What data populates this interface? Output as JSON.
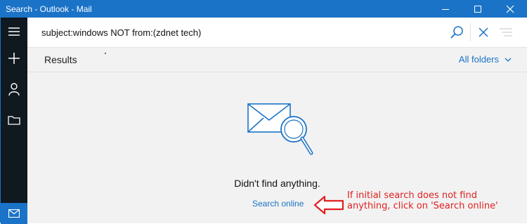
{
  "window": {
    "title": "Search - Outlook - Mail"
  },
  "search": {
    "query": "subject:windows NOT from:(zdnet tech)"
  },
  "results": {
    "label": "Results",
    "folder_filter": "All folders",
    "empty_message": "Didn't find anything.",
    "search_online_label": "Search online"
  },
  "annotation": {
    "text": "If initial search does not find anything, click on 'Search online'",
    "color": "#e02020"
  },
  "colors": {
    "accent": "#1a73c7",
    "rail": "#101820"
  },
  "icons": {
    "rail": [
      "hamburger-icon",
      "plus-icon",
      "person-icon",
      "folder-icon",
      "mail-icon"
    ],
    "title_bar": [
      "minimize-icon",
      "maximize-icon",
      "close-icon"
    ],
    "search_bar": [
      "search-icon",
      "close-icon",
      "filter-icon"
    ]
  }
}
